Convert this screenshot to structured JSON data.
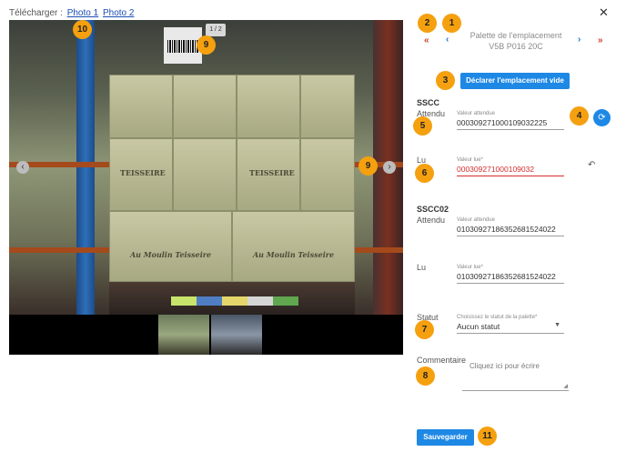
{
  "download": {
    "label": "Télécharger :",
    "photos": [
      "Photo 1",
      "Photo 2"
    ]
  },
  "viewer": {
    "counter": "1 / 2",
    "box_brand": "TEISSEIRE",
    "box_script": "Au Moulin Teisseire"
  },
  "panel": {
    "title_line1": "Palette de l'emplacement",
    "title_line2": "V5B P016 20C",
    "first_icon": "«",
    "prev_icon": "‹",
    "next_icon": "›",
    "last_icon": "»",
    "declare_empty": "Déclarer l'emplacement vide"
  },
  "sscc1": {
    "title": "SSCC",
    "expected_label": "Attendu",
    "expected_field_label": "Valeur attendue",
    "expected_value": "000309271000109032225",
    "read_label": "Lu",
    "read_field_label": "Valeur lue*",
    "read_value": "000309271000109032"
  },
  "sscc2": {
    "title": "SSCC02",
    "expected_label": "Attendu",
    "expected_field_label": "Valeur attendue",
    "expected_value": "01030927186352681524022",
    "read_label": "Lu",
    "read_field_label": "Valeur lue*",
    "read_value": "01030927186352681524022"
  },
  "status": {
    "label": "Statut",
    "field_label": "Choisissez le statut de la palette*",
    "value": "Aucun statut"
  },
  "comment": {
    "label": "Commentaire",
    "placeholder": "Cliquez ici pour écrire"
  },
  "save": "Sauvegarder",
  "badges": [
    "1",
    "2",
    "3",
    "4",
    "5",
    "6",
    "7",
    "8",
    "9",
    "9",
    "10",
    "11"
  ],
  "colors": {
    "primary": "#1e88e5",
    "badge": "#f5a00f",
    "error": "#d32f2f",
    "nav_red": "#d0402c"
  }
}
